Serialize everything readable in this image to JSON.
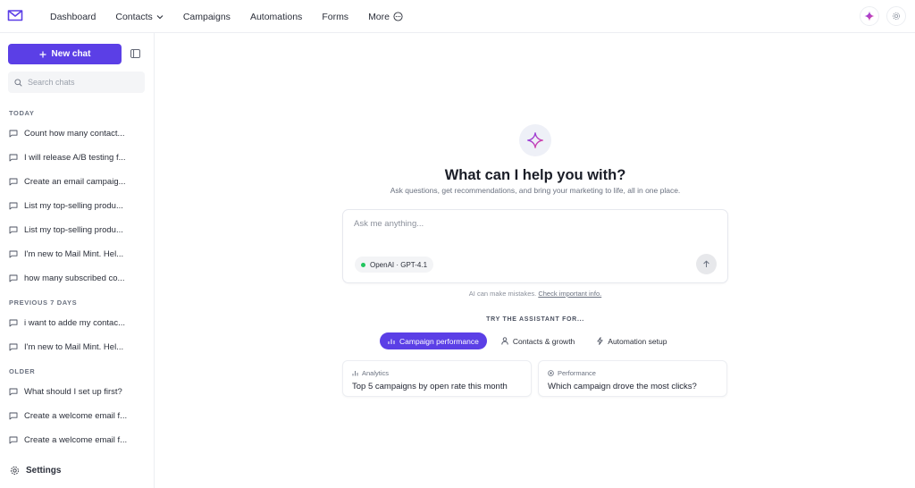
{
  "nav": {
    "items": [
      {
        "label": "Dashboard"
      },
      {
        "label": "Contacts"
      },
      {
        "label": "Campaigns"
      },
      {
        "label": "Automations"
      },
      {
        "label": "Forms"
      },
      {
        "label": "More"
      }
    ]
  },
  "sidebar": {
    "new_chat_label": "New chat",
    "search_placeholder": "Search chats",
    "sections": [
      {
        "title": "TODAY",
        "items": [
          "Count how many contact...",
          "I will release A/B testing f...",
          "Create an email campaig...",
          "List my top-selling produ...",
          "List my top-selling produ...",
          "I'm new to Mail Mint. Hel...",
          "how many subscribed co..."
        ]
      },
      {
        "title": "PREVIOUS 7 DAYS",
        "items": [
          "i want to adde my contac...",
          "I'm new to Mail Mint. Hel..."
        ]
      },
      {
        "title": "OLDER",
        "items": [
          "What should I set up first?",
          "Create a welcome email f...",
          "Create a welcome email f..."
        ]
      }
    ],
    "settings_label": "Settings"
  },
  "main": {
    "title": "What can I help you with?",
    "subtitle": "Ask questions, get recommendations, and bring your marketing to life, all in one place.",
    "composer_placeholder": "Ask me anything...",
    "model_label": "OpenAI · GPT-4.1",
    "disclaimer_text": "AI can make mistakes.",
    "disclaimer_link": "Check important info.",
    "try_label": "TRY THE ASSISTANT FOR...",
    "tabs": [
      {
        "label": "Campaign performance",
        "active": true
      },
      {
        "label": "Contacts & growth",
        "active": false
      },
      {
        "label": "Automation setup",
        "active": false
      }
    ],
    "cards": [
      {
        "category": "Analytics",
        "question": "Top 5 campaigns by open rate this month"
      },
      {
        "category": "Performance",
        "question": "Which campaign drove the most clicks?"
      }
    ]
  },
  "colors": {
    "accent": "#5b3fe6",
    "model_status": "#22c55e"
  }
}
